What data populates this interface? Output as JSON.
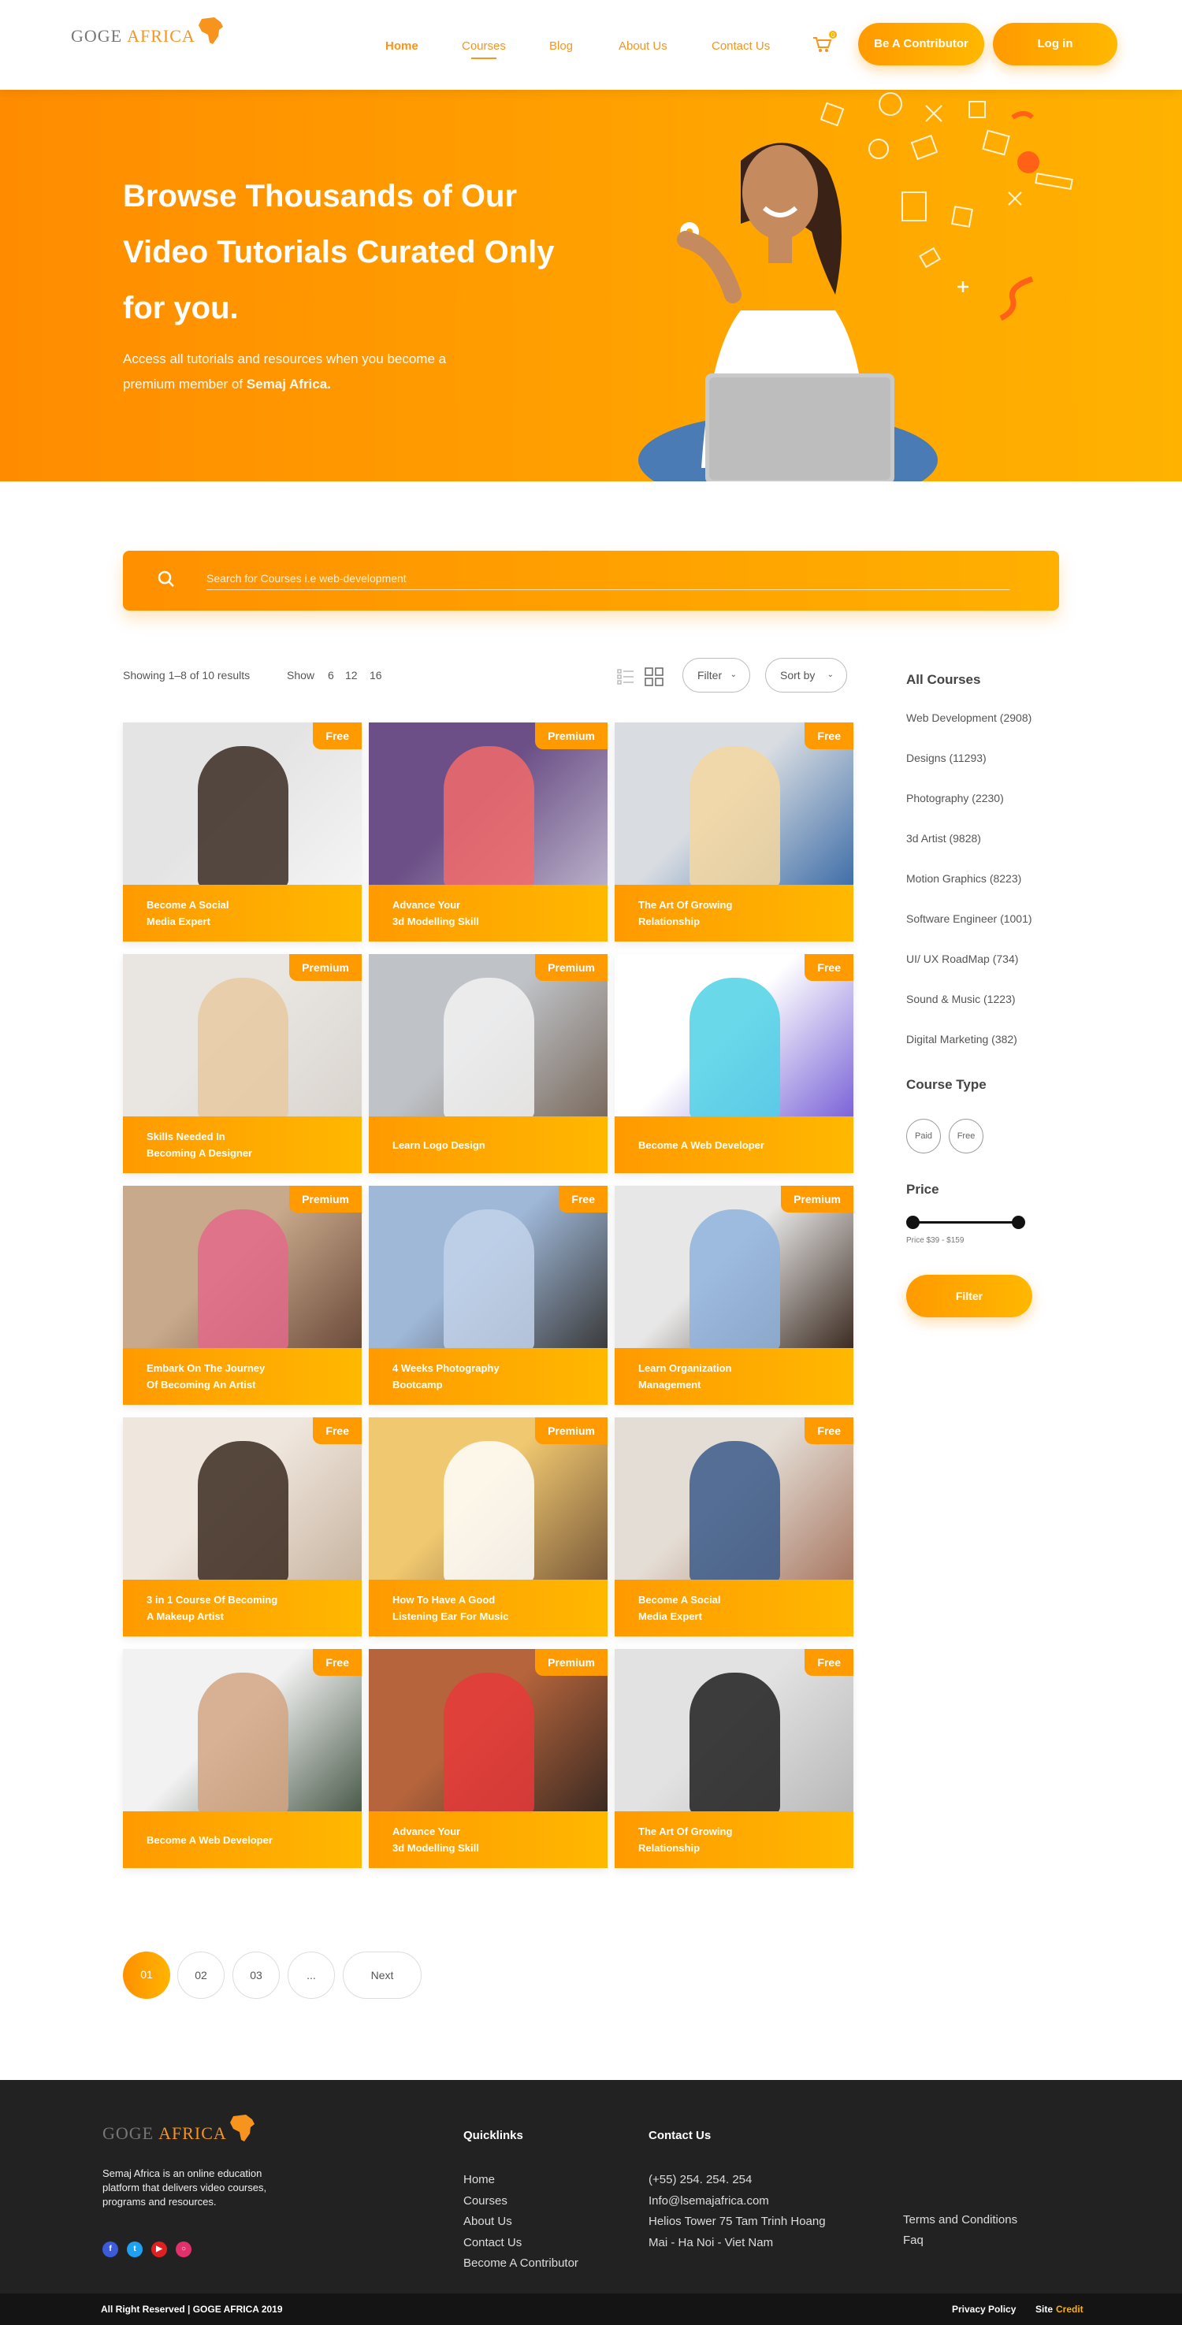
{
  "header": {
    "logo_left": "GOGE",
    "logo_right": "AFRICA",
    "nav": [
      "Home",
      "Courses",
      "Blog",
      "About Us",
      "Contact Us"
    ],
    "cart_count": "0",
    "contributor_button": "Be A Contributor",
    "login_button": "Log in"
  },
  "hero": {
    "title": "Browse Thousands of Our Video Tutorials Curated Only for you.",
    "subtitle_prefix": "Access all tutorials and resources when you become a premium member of ",
    "subtitle_brand": "Semaj Africa."
  },
  "search": {
    "placeholder": "Search for Courses i.e web-development"
  },
  "toolbar": {
    "results": "Showing 1–8 of 10 results",
    "show_label": "Show",
    "show_options": [
      "6",
      "12",
      "16"
    ],
    "filter_label": "Filter",
    "sort_label": "Sort by"
  },
  "courses": [
    {
      "title": "Become A Social\nMedia Expert",
      "badge": "Free"
    },
    {
      "title": "Advance Your\n3d Modelling Skill",
      "badge": "Premium"
    },
    {
      "title": "The Art Of Growing\nRelationship",
      "badge": "Free"
    },
    {
      "title": "Skills Needed In\nBecoming A Designer",
      "badge": "Premium"
    },
    {
      "title": "Learn Logo Design",
      "badge": "Premium"
    },
    {
      "title": "Become A Web Developer",
      "badge": "Free"
    },
    {
      "title": "Embark On The Journey\nOf Becoming An Artist",
      "badge": "Premium"
    },
    {
      "title": "4 Weeks Photography\nBootcamp",
      "badge": "Free"
    },
    {
      "title": "Learn Organization\nManagement",
      "badge": "Premium"
    },
    {
      "title": "3 in 1 Course Of Becoming\nA Makeup Artist",
      "badge": "Free"
    },
    {
      "title": "How To Have A Good\nListening Ear For Music",
      "badge": "Premium"
    },
    {
      "title": "Become A Social\nMedia Expert",
      "badge": "Free"
    },
    {
      "title": "Become A Web Developer",
      "badge": "Free"
    },
    {
      "title": "Advance Your\n3d Modelling Skill",
      "badge": "Premium"
    },
    {
      "title": "The Art Of Growing\nRelationship",
      "badge": "Free"
    }
  ],
  "sidebar": {
    "categories_title": "All Courses",
    "categories": [
      "Web Development (2908)",
      "Designs (11293)",
      "Photography (2230)",
      "3d Artist (9828)",
      "Motion Graphics (8223)",
      "Software Engineer (1001)",
      "UI/ UX RoadMap (734)",
      "Sound & Music (1223)",
      "Digital Marketing (382)"
    ],
    "type_title": "Course Type",
    "type_options": [
      "Paid",
      "Free"
    ],
    "price_title": "Price",
    "price_range": "Price $39 - $159",
    "filter_button": "Filter"
  },
  "pagination": {
    "pages": [
      "01",
      "02",
      "03",
      "..."
    ],
    "next": "Next"
  },
  "footer": {
    "logo_left": "GOGE",
    "logo_right": "AFRICA",
    "about": "Semaj Africa is an online education platform that delivers video courses, programs and resources.",
    "quicklinks_title": "Quicklinks",
    "quicklinks": [
      "Home",
      "Courses",
      "About Us",
      "Contact Us",
      "Become A Contributor"
    ],
    "contact_title": "Contact Us",
    "contact": [
      "(+55) 254. 254. 254",
      "Info@lsemajafrica.com",
      "Helios Tower 75 Tam Trinh Hoang",
      "Mai - Ha Noi - Viet Nam"
    ],
    "legal": [
      "Terms and Conditions",
      "Faq"
    ],
    "social_icons": [
      "facebook-icon",
      "twitter-icon",
      "youtube-icon",
      "instagram-icon"
    ],
    "social_colors": [
      "#3b5bdb",
      "#1da1f2",
      "#e02020",
      "#e1306c"
    ],
    "copyright": "All Right Reserved | GOGE AFRICA 2019",
    "privacy": "Privacy Policy",
    "site_label": "Site",
    "credit": "Credit"
  },
  "colors": {
    "accent": "#f7941d",
    "accent_light": "#ffb800",
    "footer_bg": "#222222"
  }
}
